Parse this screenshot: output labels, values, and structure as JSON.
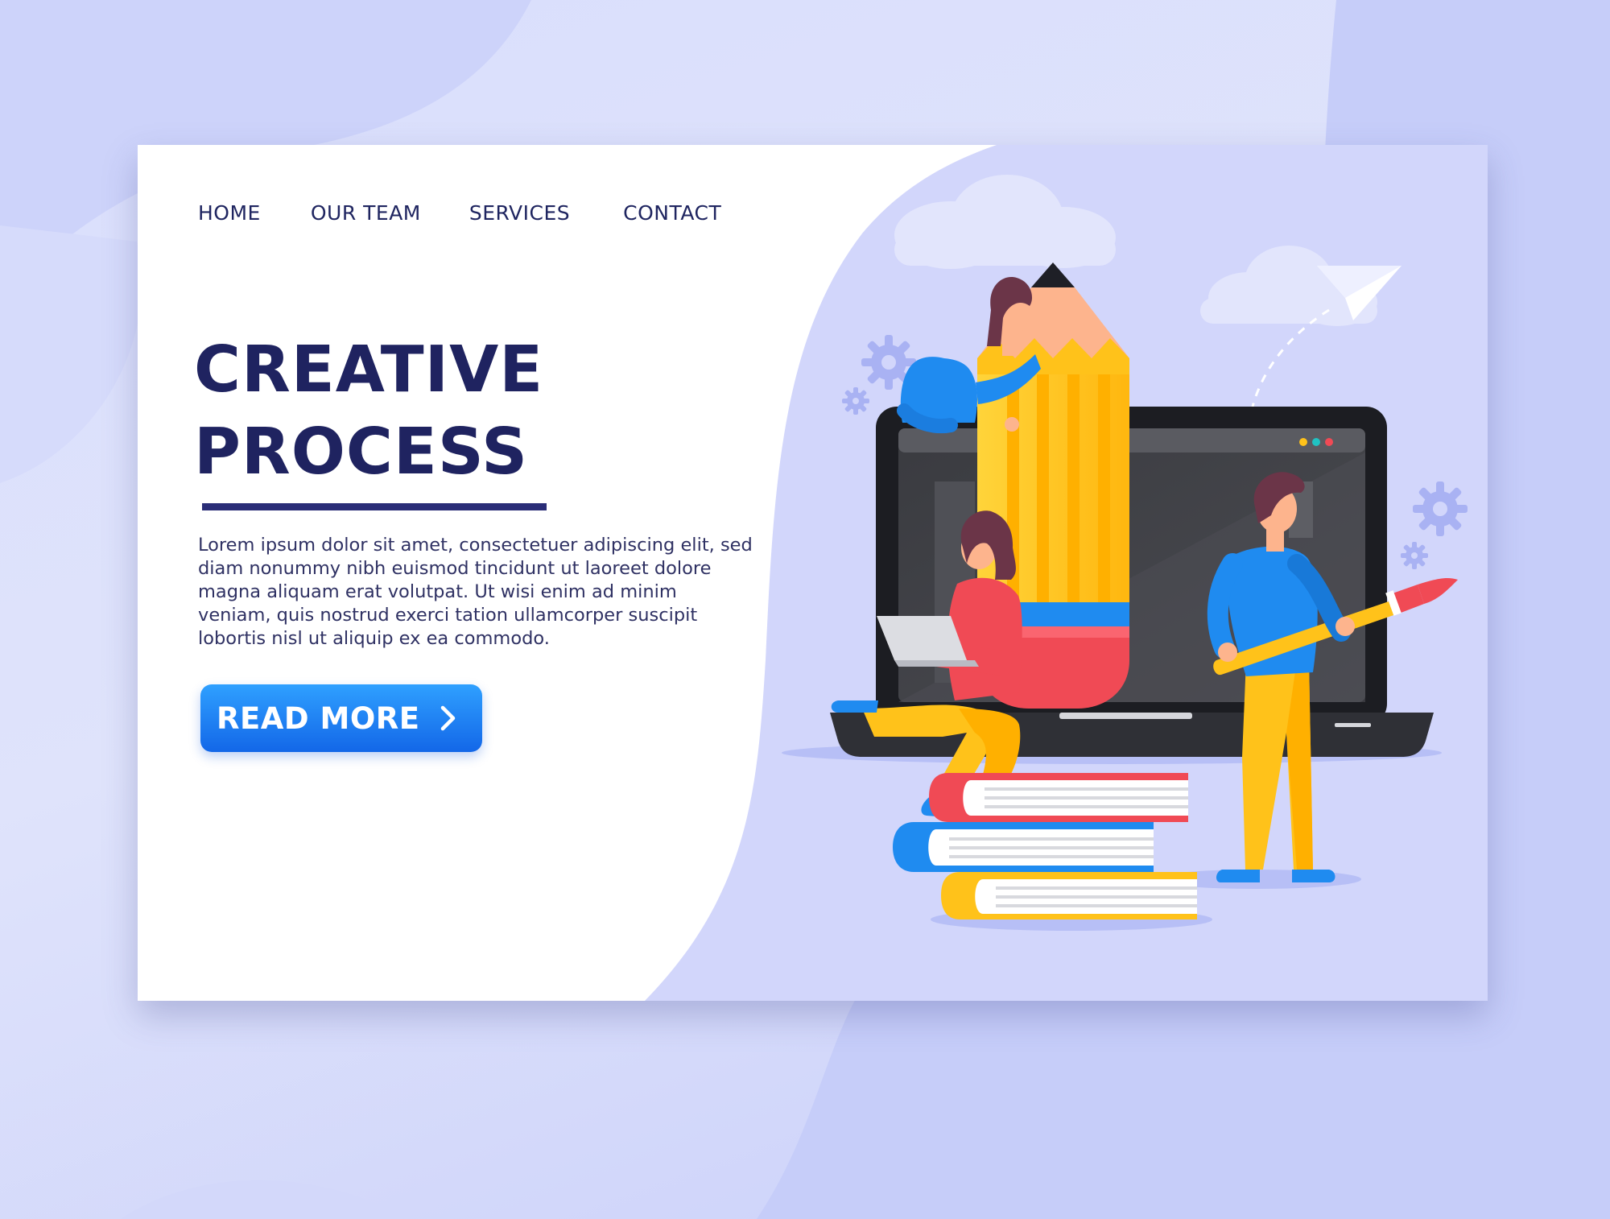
{
  "nav": {
    "items": [
      {
        "label": "HOME"
      },
      {
        "label": "OUR TEAM"
      },
      {
        "label": "SERVICES"
      },
      {
        "label": "CONTACT"
      }
    ]
  },
  "hero": {
    "title_line1": "CREATIVE",
    "title_line2": "PROCESS",
    "body": "Lorem ipsum dolor sit amet, consectetuer adipiscing elit, sed diam nonummy nibh euismod tincidunt ut laoreet dolore magna aliquam erat volutpat. Ut wisi enim ad minim veniam, quis nostrud exerci tation ullamcorper suscipit lobortis nisl ut aliquip ex ea commodo.",
    "cta_label": "READ MORE",
    "cta_icon": "chevron-right-icon"
  },
  "colors": {
    "title": "#1f2360",
    "accent_blue": "#1e7cf2",
    "illustration_bg": "#d0d5fb",
    "pencil_yellow": "#ffc21a",
    "eraser_red": "#f04a55"
  }
}
